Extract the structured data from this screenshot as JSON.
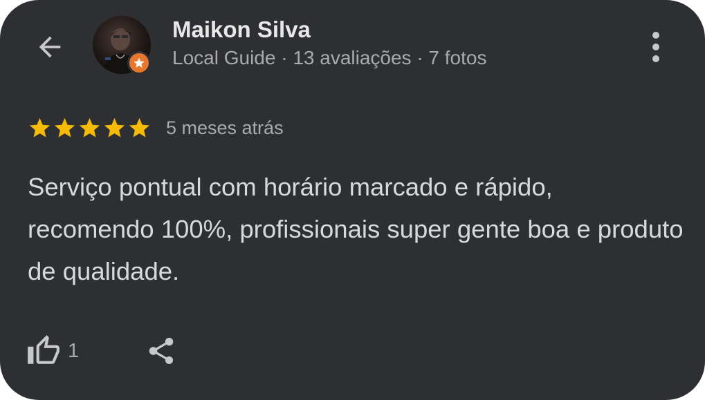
{
  "header": {
    "back_icon": "arrow-back-icon",
    "more_icon": "more-vert-icon"
  },
  "reviewer": {
    "name": "Maikon Silva",
    "meta": "Local Guide · 13 avaliações · 7 fotos",
    "badge_icon": "local-guide-star-icon",
    "badge_color": "#e8772e"
  },
  "review": {
    "rating": 5,
    "rating_max": 5,
    "star_color": "#f6bb06",
    "date": "5 meses atrás",
    "text": "Serviço pontual com horário marcado e rápido, recomendo 100%, profissionais super gente boa e produto de qualidade."
  },
  "actions": {
    "like_icon": "thumb-up-icon",
    "like_count": "1",
    "share_icon": "share-icon"
  },
  "colors": {
    "card_background": "#2e2f33",
    "primary_text": "#e8e8e8",
    "secondary_text": "#a9abae"
  }
}
